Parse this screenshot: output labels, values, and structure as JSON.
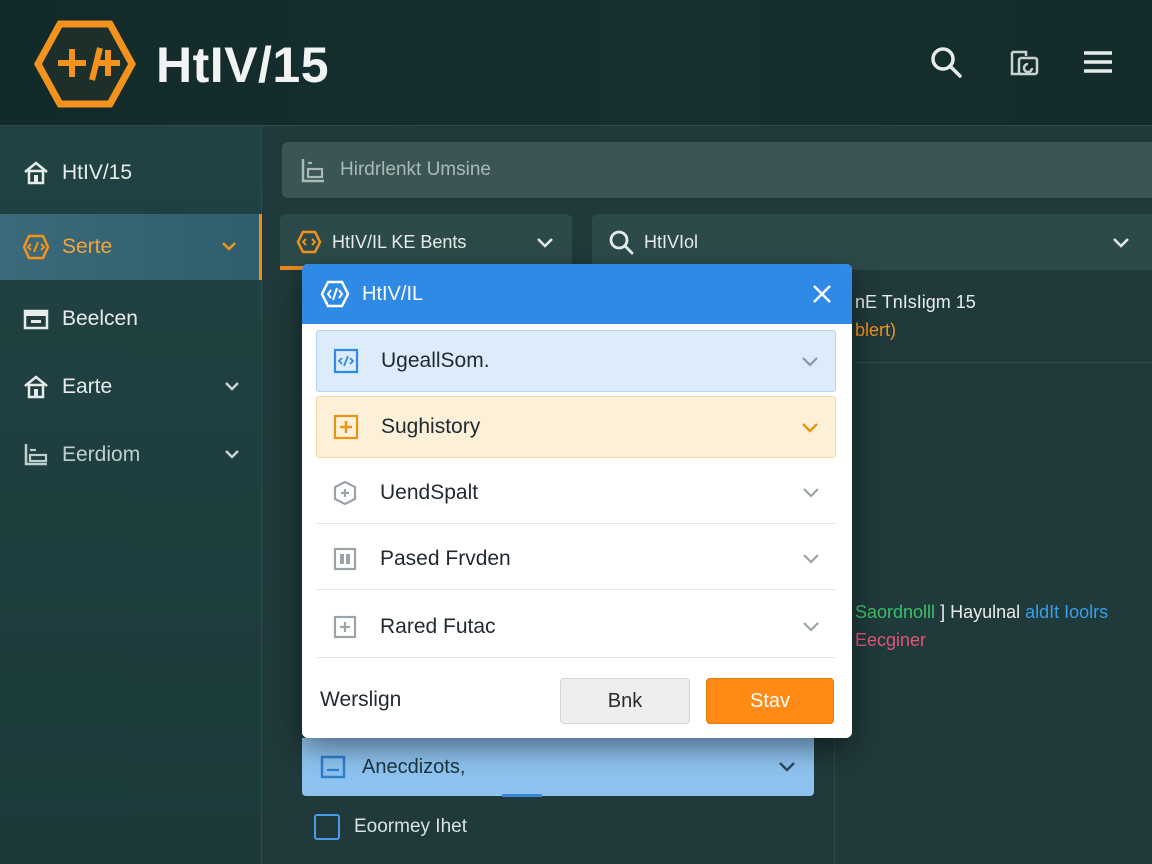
{
  "app": {
    "title": "HtIV/15"
  },
  "header": {
    "icons": [
      "search-icon",
      "copy-icon",
      "menu-icon"
    ]
  },
  "sidebar": {
    "items": [
      {
        "label": "HtIV/15",
        "icon": "home-icon",
        "state": "normal"
      },
      {
        "label": "Serte",
        "icon": "code-icon",
        "state": "active"
      },
      {
        "label": "Beelcen",
        "icon": "folder-icon",
        "state": "normal"
      },
      {
        "label": "Earte",
        "icon": "home-icon",
        "state": "normal"
      },
      {
        "label": "Eerdiom",
        "icon": "list-icon",
        "state": "muted"
      }
    ]
  },
  "main": {
    "breadcrumb": "Hirdrlenkt Umsine",
    "filter_left": "HtIV/IL KE Bents",
    "filter_right": "HtIVIol",
    "right_panel": {
      "line1": "nE TnIsIigm 15",
      "line2": "blert)",
      "line3_green": "Saordnolll",
      "line3_white": "] Hayulnal",
      "line3_blue": "aldIt Ioolrs",
      "line4": "Eecginer"
    },
    "below_item": "Anecdizots,",
    "check_label": "Eoormey Ihet"
  },
  "dialog": {
    "title": "HtIV/IL",
    "rows": [
      {
        "label": "UgeallSom.",
        "style": "blue"
      },
      {
        "label": "Sughistory",
        "style": "orange"
      },
      {
        "label": "UendSpalt",
        "style": "plain"
      },
      {
        "label": "Pased Frvden",
        "style": "plain"
      },
      {
        "label": "Rared Futac",
        "style": "plain"
      }
    ],
    "footer_label": "Werslign",
    "back_label": "Bnk",
    "save_label": "Stav"
  },
  "colors": {
    "accent_orange": "#ff8a16",
    "dialog_blue": "#2f8ae5",
    "background": "#1f3b3c"
  }
}
